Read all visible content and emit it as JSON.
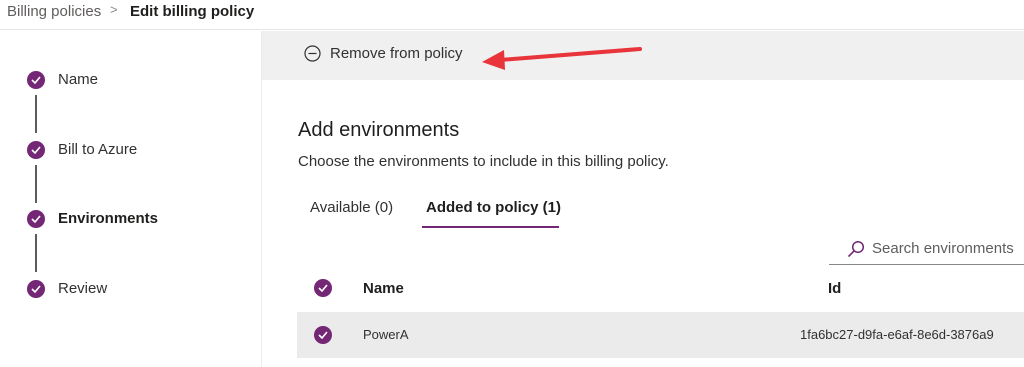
{
  "breadcrumb": {
    "parent": "Billing policies",
    "separator": ">",
    "current": "Edit billing policy"
  },
  "steps": [
    {
      "label": "Name",
      "status": "complete"
    },
    {
      "label": "Bill to Azure",
      "status": "complete"
    },
    {
      "label": "Environments",
      "status": "current"
    },
    {
      "label": "Review",
      "status": "complete"
    }
  ],
  "command_bar": {
    "remove_label": "Remove from policy",
    "remove_icon": "minus-circle-icon"
  },
  "annotation": {
    "arrow_color": "#e8343a"
  },
  "main": {
    "title": "Add environments",
    "subtitle": "Choose the environments to include in this billing policy.",
    "tabs": [
      {
        "label": "Available (0)",
        "selected": false
      },
      {
        "label": "Added to policy (1)",
        "selected": true
      }
    ],
    "search": {
      "placeholder": "Search environments",
      "icon": "search-icon"
    },
    "table": {
      "columns": [
        "Name",
        "Id"
      ],
      "rows": [
        {
          "name": "PowerA",
          "id": "1fa6bc27-d9fa-e6af-8e6d-3876a9",
          "selected": true
        }
      ]
    }
  },
  "colors": {
    "accent": "#742774",
    "command_bar_bg": "#f0f0f0",
    "selected_row_bg": "#ebebeb"
  }
}
